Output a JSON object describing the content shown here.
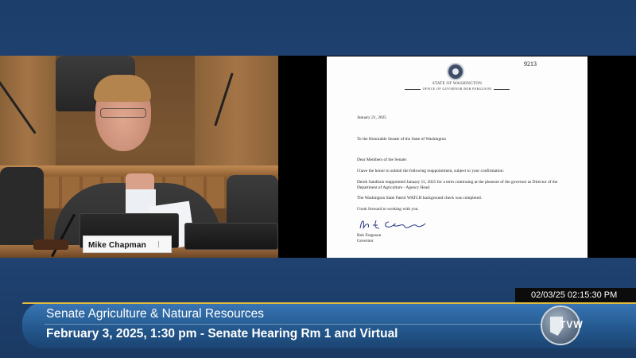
{
  "letter": {
    "document_number": "9213",
    "letterhead_line1": "STATE OF WASHINGTON",
    "letterhead_line2": "OFFICE OF GOVERNOR BOB FERGUSON",
    "date": "January 21, 2025",
    "addressee": "To the Honorable Senate of the State of Washington",
    "salutation": "Dear Members of the Senate:",
    "intro": "I have the honor to submit the following reappointment, subject to your confirmation:",
    "paragraph1": "Derek Sandison reappointed January 15, 2025 for a term continuing at the pleasure of the governor as Director of the Department of Agriculture - Agency Head.",
    "paragraph2": "The Washington State Patrol WATCH background check was completed.",
    "closing": "I look forward to working with you.",
    "signer_name": "Bob Ferguson",
    "signer_title": "Governor"
  },
  "nameplate": {
    "name": "Mike Chapman"
  },
  "timestamp": "02/03/25 02:15:30 PM",
  "lower_third": {
    "line1": "Senate Agriculture & Natural Resources",
    "line2": "February 3, 2025, 1:30 pm - Senate Hearing Rm 1 and Virtual"
  },
  "logo": {
    "text": "TVW"
  },
  "colors": {
    "background": "#1d3f6b",
    "lower_third": "#24598f",
    "accent": "#e0b93e"
  },
  "icons": {
    "logo": "tvw-logo",
    "seal": "state-seal-icon"
  }
}
